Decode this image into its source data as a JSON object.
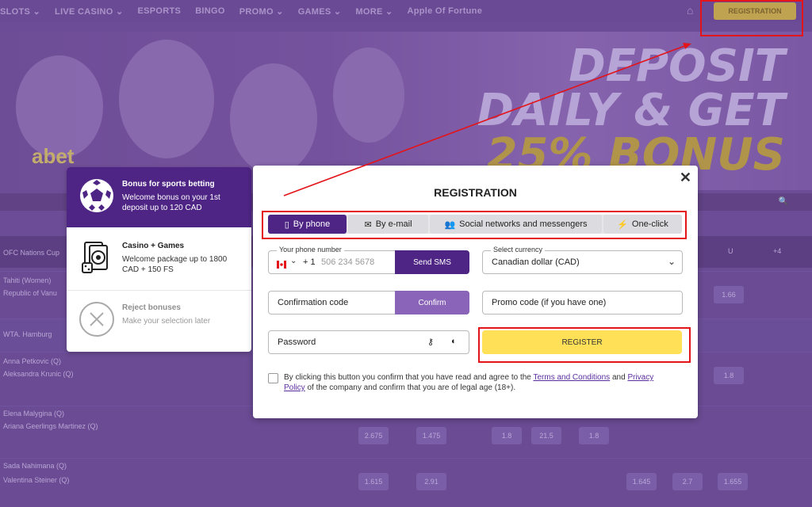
{
  "topnav": {
    "items": [
      "SLOTS ⌄",
      "LIVE CASINO ⌄",
      "ESPORTS",
      "BINGO",
      "PROMO ⌄",
      "GAMES ⌄",
      "MORE ⌄",
      "Apple Of Fortune"
    ],
    "registration_label": "REGISTRATION"
  },
  "banner": {
    "line1": "DEPOSIT",
    "line2": "DAILY & GET",
    "line3": "25% BONUS",
    "brand": "abet"
  },
  "background_table": {
    "rows": [
      {
        "l1": "OFC Nations Cup",
        "l2": ""
      },
      {
        "l1": "Tahiti (Women)",
        "l2": "Republic of Vanu"
      },
      {
        "l1": "WTA. Hamburg",
        "l2": ""
      },
      {
        "l1": "Anna Petkovic (Q)",
        "l2": "Aleksandra Krunic (Q)"
      },
      {
        "l1": "Elena Malygina (Q)",
        "l2": "Ariana Geerlings Martinez (Q)"
      },
      {
        "l1": "Sada Nahimana (Q)",
        "l2": "Valentina Steiner (Q)"
      }
    ],
    "cells": [
      "1.66",
      "2.675",
      "1.475",
      "1.8",
      "21.5",
      "1.8",
      "1.615",
      "2.91",
      "1.645",
      "2.7",
      "1.655"
    ]
  },
  "bonus_panel": {
    "sports": {
      "title": "Bonus for sports betting",
      "desc": "Welcome bonus on your 1st deposit up to 120 CAD",
      "icon": "soccer-ball-icon"
    },
    "casino": {
      "title": "Casino + Games",
      "desc": "Welcome package up to 1800 CAD + 150 FS",
      "icon": "cards-chips-dice-icon"
    },
    "reject": {
      "title": "Reject bonuses",
      "desc": "Make your selection later",
      "icon": "close-circle-icon"
    }
  },
  "modal": {
    "title": "REGISTRATION",
    "tabs": [
      {
        "label": "By phone",
        "icon": "phone-icon"
      },
      {
        "label": "By e-mail",
        "icon": "envelope-icon"
      },
      {
        "label": "Social networks and messengers",
        "icon": "people-icon"
      },
      {
        "label": "One-click",
        "icon": "lightning-icon"
      }
    ],
    "phone": {
      "label": "Your phone number",
      "country_code": "+ 1",
      "placeholder": "506 234 5678",
      "send_sms": "Send SMS"
    },
    "currency": {
      "label": "Select currency",
      "value": "Canadian dollar (CAD)"
    },
    "confirmation": {
      "placeholder": "Confirmation code",
      "confirm": "Confirm"
    },
    "promo": {
      "placeholder": "Promo code (if you have one)"
    },
    "password": {
      "placeholder": "Password"
    },
    "register_label": "REGISTER",
    "terms": {
      "prefix": "By clicking this button you confirm that you have read and agree to the",
      "terms_link": "Terms and Conditions",
      "and": "and",
      "privacy_link": "Privacy Policy",
      "suffix": "of the company and confirm that you are of legal age (18+)."
    }
  },
  "colors": {
    "purple": "#4e2585",
    "yellow": "#ffe057",
    "annotation_red": "#e3141a"
  }
}
